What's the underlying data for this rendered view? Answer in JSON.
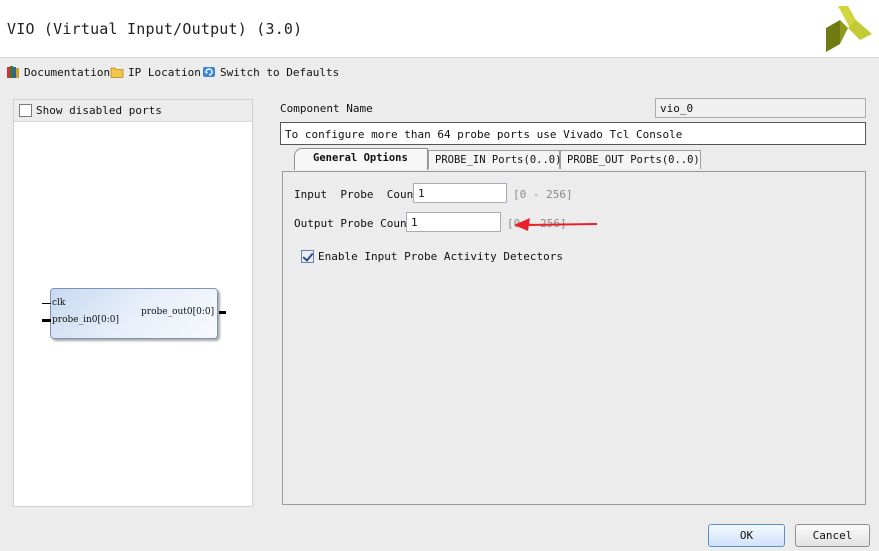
{
  "window": {
    "title": "VIO (Virtual Input/Output) (3.0)"
  },
  "toolbar": {
    "items": [
      {
        "label": "Documentation",
        "icon": "documentation-icon"
      },
      {
        "label": "IP Location",
        "icon": "folder-icon"
      },
      {
        "label": "Switch to Defaults",
        "icon": "refresh-icon"
      }
    ]
  },
  "left_panel": {
    "show_disabled_ports_label": "Show disabled ports",
    "show_disabled_ports_checked": false,
    "block": {
      "ports_in": [
        "clk",
        "probe_in0[0:0]"
      ],
      "ports_out": [
        "probe_out0[0:0]"
      ]
    }
  },
  "component": {
    "name_label": "Component Name",
    "name_value": "vio_0",
    "notice": "To configure more than 64 probe ports use Vivado Tcl Console"
  },
  "tabs": [
    {
      "label": "General Options",
      "active": true
    },
    {
      "label": "PROBE_IN Ports(0..0)",
      "active": false
    },
    {
      "label": "PROBE_OUT Ports(0..0)",
      "active": false
    }
  ],
  "general": {
    "input_probe_label": "Input  Probe  Count",
    "input_probe_value": "1",
    "input_probe_range": "[0 - 256]",
    "output_probe_label": "Output Probe Count",
    "output_probe_value": "1",
    "output_probe_range": "[0 - 256]",
    "activity_detectors_label": "Enable Input Probe Activity Detectors",
    "activity_detectors_checked": true
  },
  "buttons": {
    "ok": "OK",
    "cancel": "Cancel"
  },
  "colors": {
    "arrow": "#e8202a",
    "logo_dark": "#7f8b17",
    "logo_light": "#c9d23f",
    "ok_border": "#5b8fcf"
  }
}
